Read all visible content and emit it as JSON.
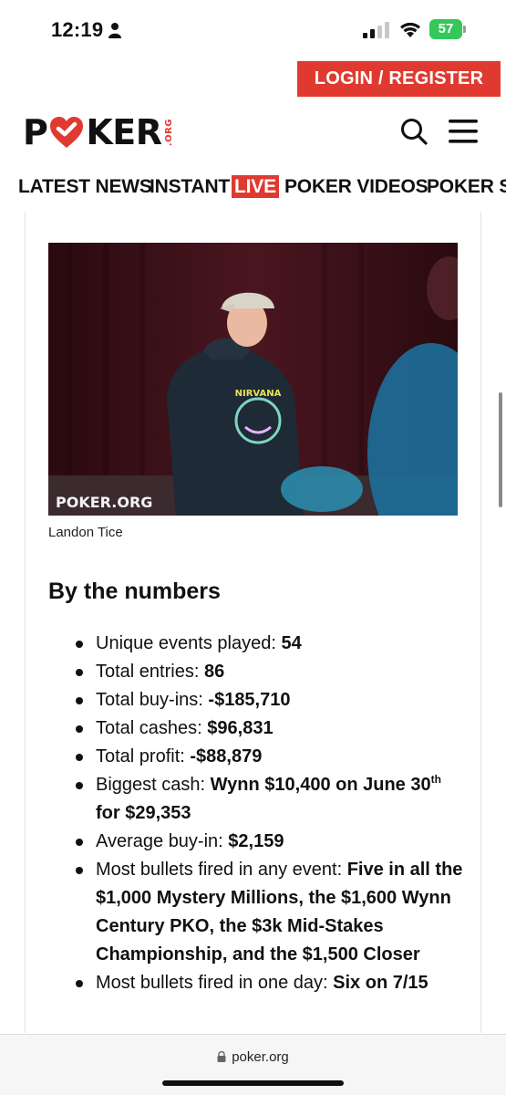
{
  "status_bar": {
    "time": "12:19",
    "battery": "57"
  },
  "header": {
    "login_label": "LOGIN / REGISTER",
    "logo": {
      "left": "P",
      "right": "KER",
      "suffix": ".ORG"
    }
  },
  "nav": {
    "items": [
      {
        "label": "LATEST NEWS"
      },
      {
        "label": "INSTANT",
        "badge": "LIVE"
      },
      {
        "label": "POKER VIDEOS"
      },
      {
        "label": "POKER STR"
      }
    ]
  },
  "article": {
    "photo_watermark": "POKER.ORG",
    "caption": "Landon Tice",
    "heading": "By the numbers",
    "stats": [
      {
        "label": "Unique events played:",
        "value": "54"
      },
      {
        "label": "Total entries:",
        "value": "86"
      },
      {
        "label": "Total buy-ins:",
        "value": "-$185,710"
      },
      {
        "label": "Total cashes:",
        "value": "$96,831"
      },
      {
        "label": "Total profit:",
        "value": "-$88,879"
      },
      {
        "label": "Biggest cash:",
        "value": "Wynn $10,400 on June 30",
        "sup": "th",
        "value_tail": "for $29,353"
      },
      {
        "label": "Average buy-in:",
        "value": "$2,159"
      },
      {
        "label": "Most bullets fired in any event:",
        "value": "Five in all the $1,000 Mystery Millions, the $1,600 Wynn Century PKO, the $3k Mid-Stakes Championship, and the $1,500 Closer"
      },
      {
        "label": "Most bullets fired in one day:",
        "value": "Six on 7/15"
      }
    ]
  },
  "browser": {
    "url": "poker.org"
  },
  "colors": {
    "brand_red": "#e03a30",
    "battery_green": "#34c759"
  }
}
